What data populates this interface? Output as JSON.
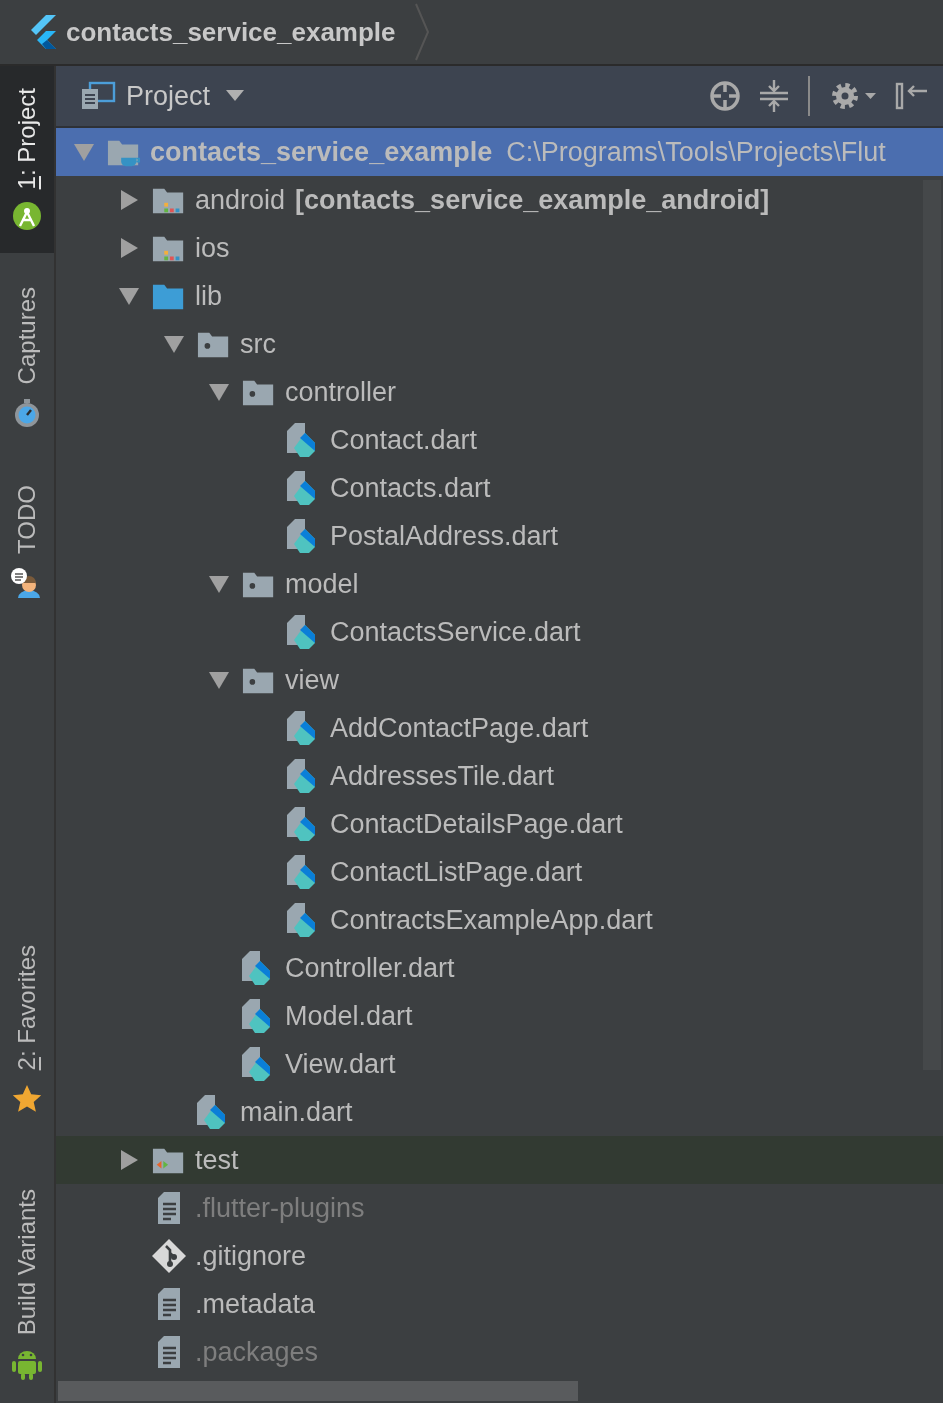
{
  "breadcrumb": {
    "title": "contacts_service_example"
  },
  "side_tabs": [
    {
      "label": "1: Project",
      "mnemonic": true,
      "selected": true,
      "kind": "android_head",
      "bottom_group": false
    },
    {
      "label": "Captures",
      "mnemonic": false,
      "selected": false,
      "kind": "stopwatch",
      "bottom_group": false
    },
    {
      "label": "TODO",
      "mnemonic": false,
      "selected": false,
      "kind": "todo",
      "bottom_group": false
    },
    {
      "label": "2: Favorites",
      "mnemonic": true,
      "selected": false,
      "kind": "star",
      "bottom_group": true
    },
    {
      "label": "Build Variants",
      "mnemonic": false,
      "selected": false,
      "kind": "android_robot",
      "bottom_group": true
    }
  ],
  "panel": {
    "title": "Project"
  },
  "tree": [
    {
      "kind": "project_root",
      "label": "contacts_service_example",
      "path": "C:\\Programs\\Tools\\Projects\\Flut",
      "selected": true,
      "expanded": true,
      "dimmed": false,
      "children": [
        {
          "kind": "module_folder",
          "label": "android",
          "module": "[contacts_service_example_android]",
          "selected": false,
          "expanded": false,
          "dimmed": false
        },
        {
          "kind": "module_folder",
          "label": "ios",
          "selected": false,
          "expanded": false,
          "dimmed": false
        },
        {
          "kind": "source_folder",
          "label": "lib",
          "selected": false,
          "expanded": true,
          "dimmed": false,
          "children": [
            {
              "kind": "package_folder",
              "label": "src",
              "selected": false,
              "expanded": true,
              "dimmed": false,
              "children": [
                {
                  "kind": "package_folder",
                  "label": "controller",
                  "selected": false,
                  "expanded": true,
                  "dimmed": false,
                  "children": [
                    {
                      "kind": "dart_file",
                      "label": "Contact.dart",
                      "selected": false,
                      "dimmed": false
                    },
                    {
                      "kind": "dart_file",
                      "label": "Contacts.dart",
                      "selected": false,
                      "dimmed": false
                    },
                    {
                      "kind": "dart_file",
                      "label": "PostalAddress.dart",
                      "selected": false,
                      "dimmed": false
                    }
                  ]
                },
                {
                  "kind": "package_folder",
                  "label": "model",
                  "selected": false,
                  "expanded": true,
                  "dimmed": false,
                  "children": [
                    {
                      "kind": "dart_file",
                      "label": "ContactsService.dart",
                      "selected": false,
                      "dimmed": false
                    }
                  ]
                },
                {
                  "kind": "package_folder",
                  "label": "view",
                  "selected": false,
                  "expanded": true,
                  "dimmed": false,
                  "children": [
                    {
                      "kind": "dart_file",
                      "label": "AddContactPage.dart",
                      "selected": false,
                      "dimmed": false
                    },
                    {
                      "kind": "dart_file",
                      "label": "AddressesTile.dart",
                      "selected": false,
                      "dimmed": false
                    },
                    {
                      "kind": "dart_file",
                      "label": "ContactDetailsPage.dart",
                      "selected": false,
                      "dimmed": false
                    },
                    {
                      "kind": "dart_file",
                      "label": "ContactListPage.dart",
                      "selected": false,
                      "dimmed": false
                    },
                    {
                      "kind": "dart_file",
                      "label": "ContractsExampleApp.dart",
                      "selected": false,
                      "dimmed": false
                    }
                  ]
                },
                {
                  "kind": "dart_file",
                  "label": "Controller.dart",
                  "selected": false,
                  "dimmed": false
                },
                {
                  "kind": "dart_file",
                  "label": "Model.dart",
                  "selected": false,
                  "dimmed": false
                },
                {
                  "kind": "dart_file",
                  "label": "View.dart",
                  "selected": false,
                  "dimmed": false
                }
              ]
            },
            {
              "kind": "dart_file",
              "label": "main.dart",
              "selected": false,
              "dimmed": false
            }
          ]
        },
        {
          "kind": "test_folder",
          "label": "test",
          "selected": false,
          "expanded": false,
          "dimmed": false
        },
        {
          "kind": "text_file",
          "label": ".flutter-plugins",
          "selected": false,
          "dimmed": true
        },
        {
          "kind": "git_file",
          "label": ".gitignore",
          "selected": false,
          "dimmed": false
        },
        {
          "kind": "text_file",
          "label": ".metadata",
          "selected": false,
          "dimmed": false
        },
        {
          "kind": "text_file",
          "label": ".packages",
          "selected": false,
          "dimmed": true
        }
      ]
    }
  ]
}
